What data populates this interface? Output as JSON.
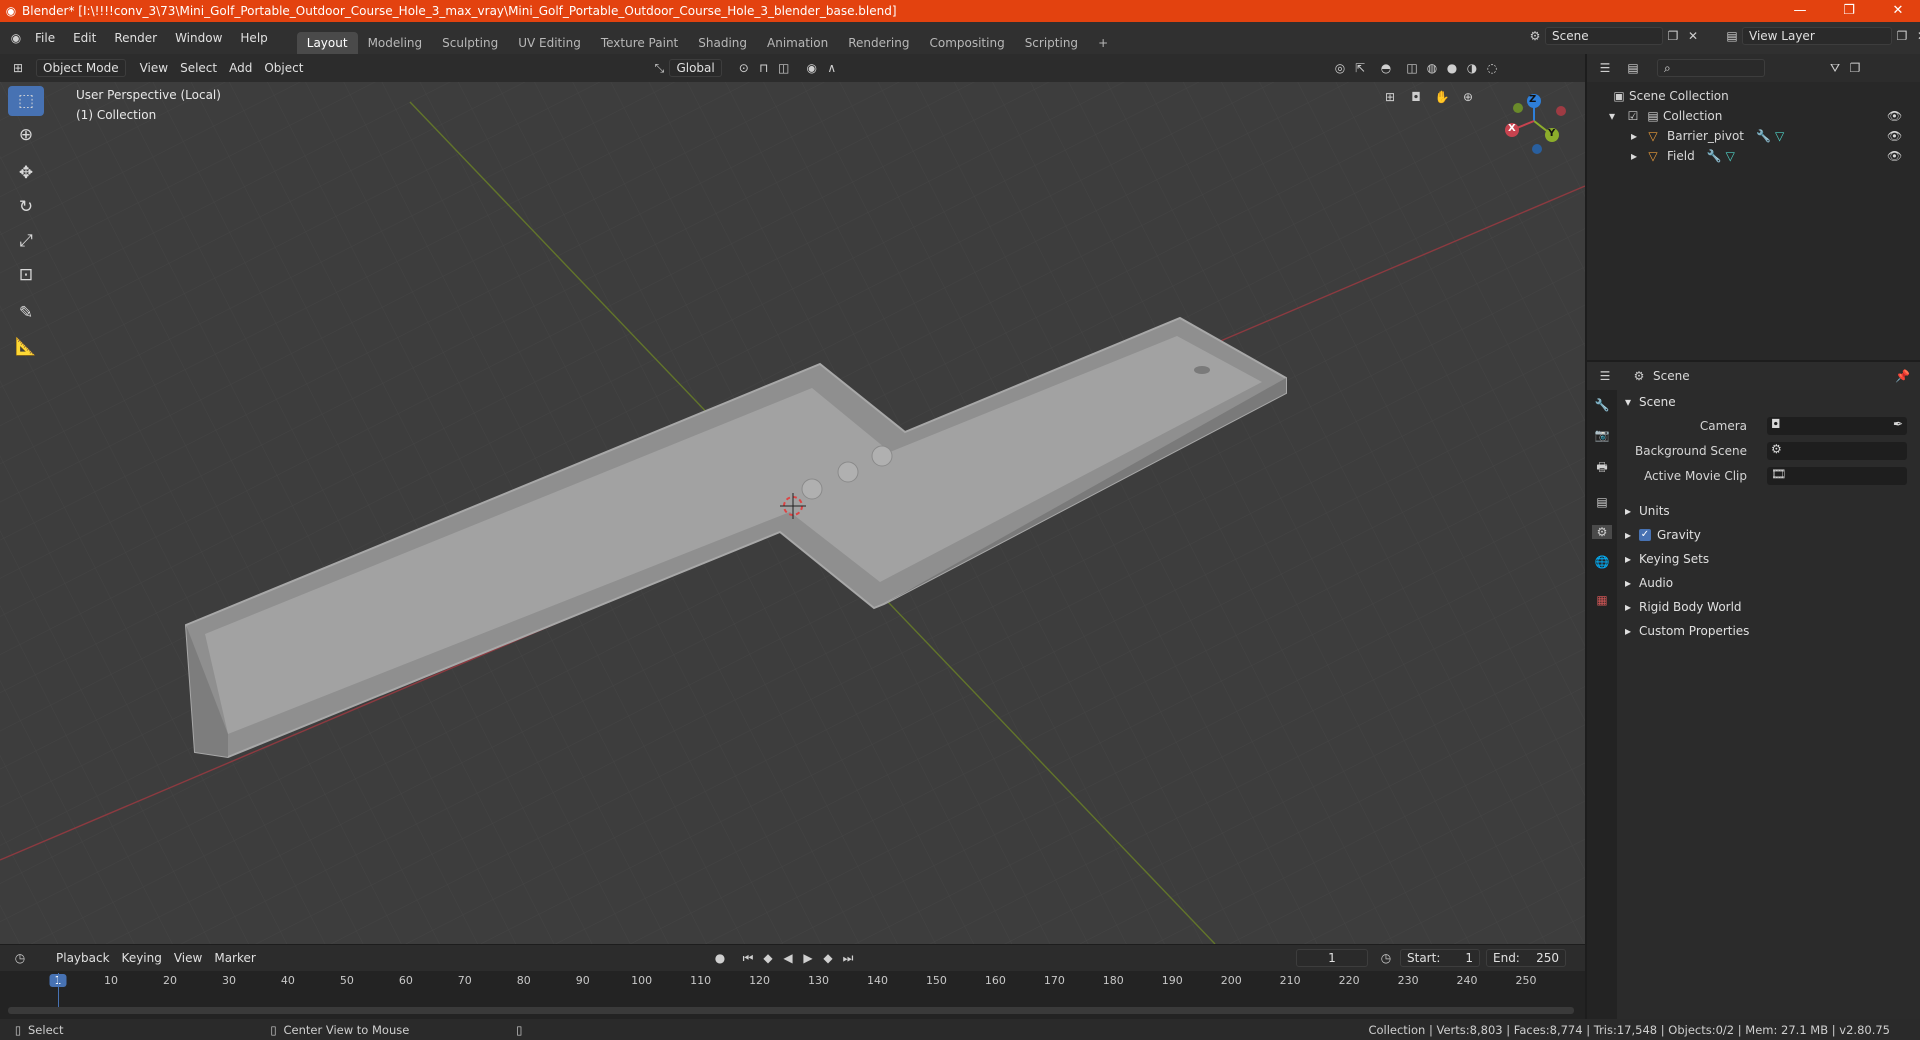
{
  "window": {
    "title": "Blender* [I:\\!!!!conv_3\\73\\Mini_Golf_Portable_Outdoor_Course_Hole_3_max_vray\\Mini_Golf_Portable_Outdoor_Course_Hole_3_blender_base.blend]",
    "minimize": "—",
    "maximize": "❐",
    "close": "✕"
  },
  "menu": [
    "File",
    "Edit",
    "Render",
    "Window",
    "Help"
  ],
  "workspaces": [
    "Layout",
    "Modeling",
    "Sculpting",
    "UV Editing",
    "Texture Paint",
    "Shading",
    "Animation",
    "Rendering",
    "Compositing",
    "Scripting"
  ],
  "workspace_add": "+",
  "scene_selector": {
    "value": "Scene"
  },
  "viewlayer_selector": {
    "value": "View Layer"
  },
  "viewport_header": {
    "mode": "Object Mode",
    "menus": [
      "View",
      "Select",
      "Add",
      "Object"
    ],
    "transform": "Global"
  },
  "viewport": {
    "info_line1": "User Perspective (Local)",
    "info_line2": "(1) Collection",
    "gizmo": {
      "x": "X",
      "y": "Y",
      "z": "Z"
    }
  },
  "outliner": {
    "root": "Scene Collection",
    "collection": "Collection",
    "items": [
      "Barrier_pivot",
      "Field"
    ]
  },
  "properties": {
    "header": "Scene",
    "panel_title": "Scene",
    "fields": {
      "camera": "Camera",
      "background_scene": "Background Scene",
      "active_movie_clip": "Active Movie Clip"
    },
    "subpanels": [
      "Units",
      "Gravity",
      "Keying Sets",
      "Audio",
      "Rigid Body World",
      "Custom Properties"
    ]
  },
  "timeline": {
    "menus": [
      "Playback",
      "Keying",
      "View",
      "Marker"
    ],
    "current_frame": "1",
    "start_label": "Start:",
    "start": "1",
    "end_label": "End:",
    "end": "250",
    "ticks": [
      "1",
      "10",
      "20",
      "30",
      "40",
      "50",
      "60",
      "70",
      "80",
      "90",
      "100",
      "110",
      "120",
      "130",
      "140",
      "150",
      "160",
      "170",
      "180",
      "190",
      "200",
      "210",
      "220",
      "230",
      "240",
      "250"
    ]
  },
  "status": {
    "select": "Select",
    "center_view": "Center View to Mouse",
    "stats": "Collection | Verts:8,803 | Faces:8,774 | Tris:17,548 | Objects:0/2 | Mem: 27.1 MB | v2.80.75"
  },
  "colors": {
    "accent": "#4772b3",
    "title": "#e3420f",
    "x_axis": "#c8434f",
    "y_axis": "#8cad2b",
    "z_axis": "#2e7fd9"
  }
}
